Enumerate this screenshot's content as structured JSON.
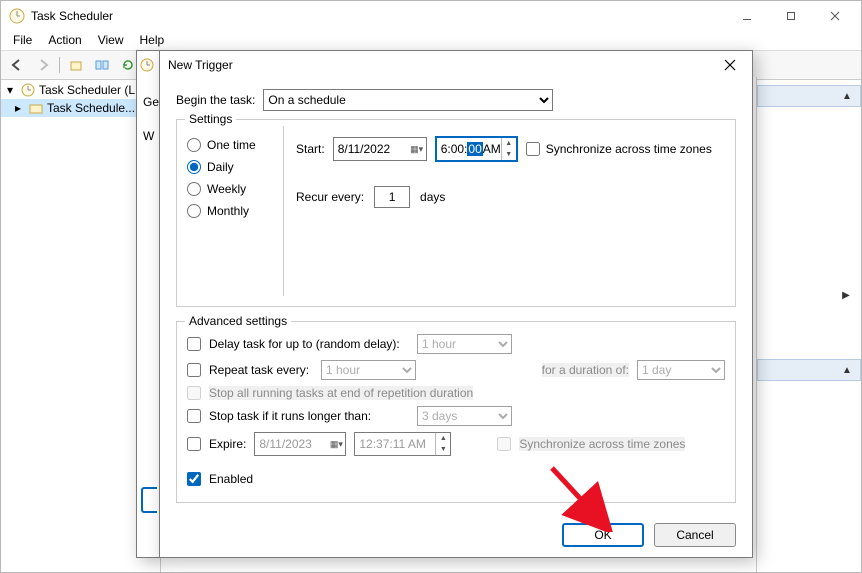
{
  "app": {
    "title": "Task Scheduler",
    "menu": {
      "file": "File",
      "action": "Action",
      "view": "View",
      "help": "Help"
    }
  },
  "tree": {
    "root": "Task Scheduler (L...",
    "lib": "Task Schedule..."
  },
  "dialog": {
    "title": "New Trigger",
    "begin_label": "Begin the task:",
    "begin_value": "On a schedule",
    "settings_legend": "Settings",
    "periodicity": {
      "one_time": "One time",
      "daily": "Daily",
      "weekly": "Weekly",
      "monthly": "Monthly"
    },
    "start_label": "Start:",
    "start_date": "8/11/2022",
    "start_time_prefix": "6:00:",
    "start_time_sel": "00",
    "start_time_suffix": " AM",
    "sync_tz": "Synchronize across time zones",
    "recur_label": "Recur every:",
    "recur_value": "1",
    "recur_unit": "days",
    "advanced_legend": "Advanced settings",
    "delay_label": "Delay task for up to (random delay):",
    "delay_value": "1 hour",
    "repeat_label": "Repeat task every:",
    "repeat_value": "1 hour",
    "duration_label": "for a duration of:",
    "duration_value": "1 day",
    "stop_all_label": "Stop all running tasks at end of repetition duration",
    "stop_longer_label": "Stop task if it runs longer than:",
    "stop_longer_value": "3 days",
    "expire_label": "Expire:",
    "expire_date": "8/11/2023",
    "expire_time": "12:37:11 AM",
    "sync_tz2": "Synchronize across time zones",
    "enabled_label": "Enabled",
    "ok": "OK",
    "cancel": "Cancel"
  },
  "behind": {
    "gen": "Gen",
    "w": "W"
  }
}
